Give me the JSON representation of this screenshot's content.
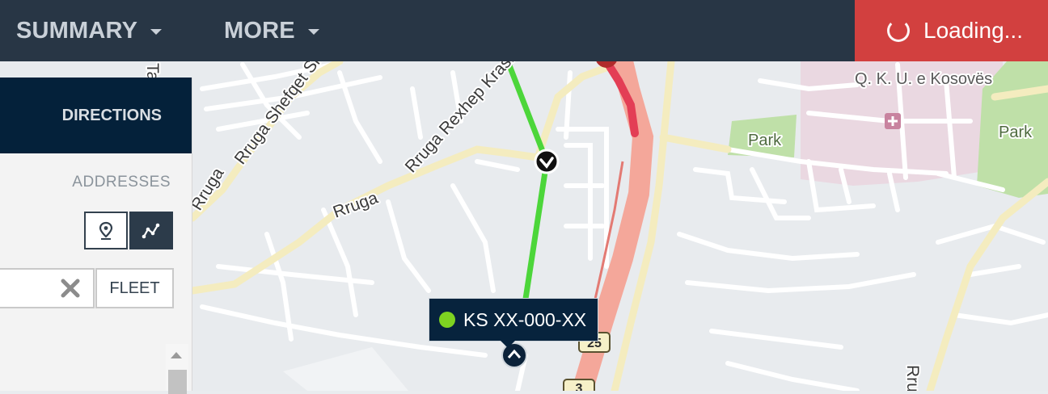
{
  "topbar": {
    "nav": [
      {
        "label": "SUMMARY"
      },
      {
        "label": "MORE"
      }
    ],
    "loading_label": "Loading...",
    "colors": {
      "bar": "#283645",
      "loading": "#d2403f"
    }
  },
  "panel": {
    "header": "DIRECTIONS",
    "section_label": "ADDRESSES",
    "mode_buttons": [
      {
        "icon": "map-pin-icon",
        "active": false
      },
      {
        "icon": "route-icon",
        "active": true
      }
    ],
    "search": {
      "value": "",
      "placeholder": ""
    },
    "fleet_label": "FLEET"
  },
  "map": {
    "streets": [
      "Rruga Shefqet Shkupi",
      "Rruga Rexhep Krasniqi",
      "Rruga",
      "Rru",
      "Ta"
    ],
    "poi": [
      {
        "name": "Park"
      },
      {
        "name": "Park"
      },
      {
        "name": "Q. K. U. e Kosovës"
      }
    ],
    "road_shields": [
      "25",
      "3"
    ],
    "route_color": "#4cd63a",
    "vehicle": {
      "plate": "KS XX-000-XX",
      "status_color": "#7ed321"
    }
  }
}
